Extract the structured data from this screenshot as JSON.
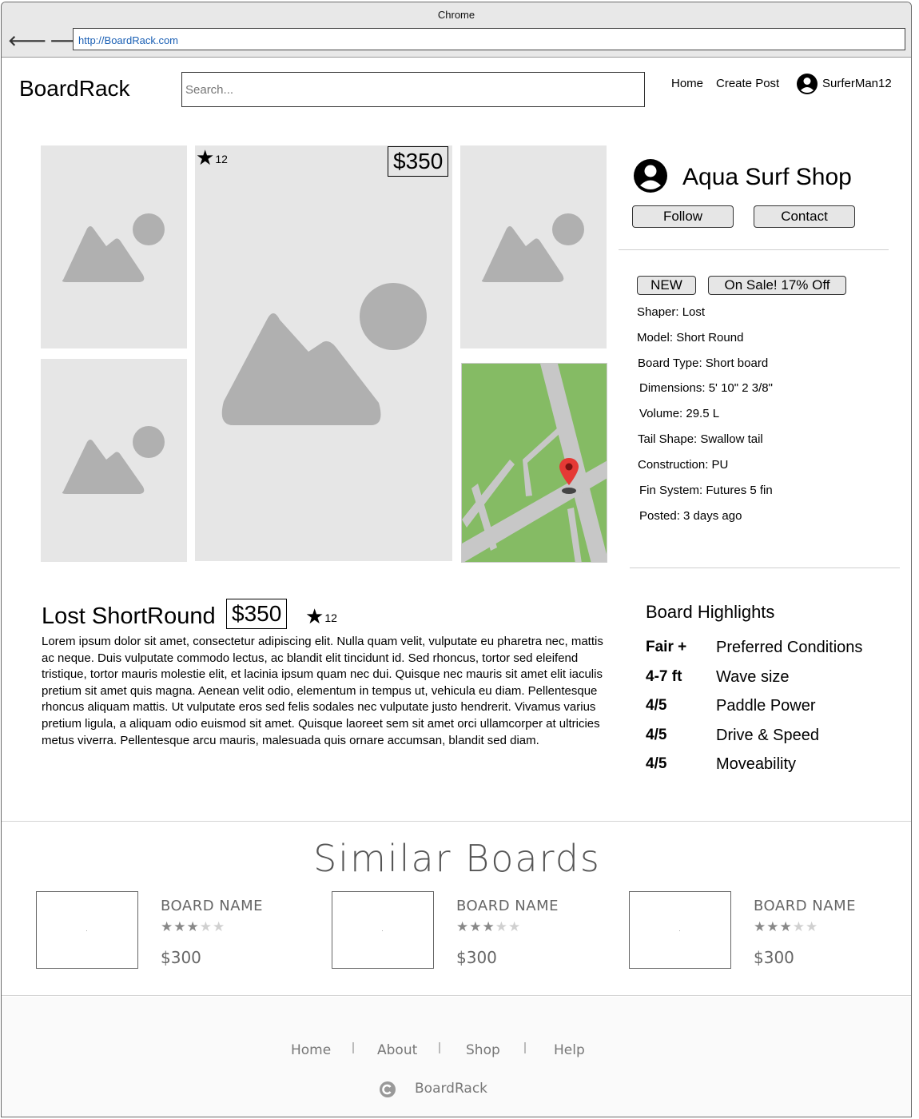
{
  "browser": {
    "title": "Chrome",
    "url": "http://BoardRack.com"
  },
  "header": {
    "logo": "BoardRack",
    "search_placeholder": "Search...",
    "nav": {
      "home": "Home",
      "create_post": "Create Post",
      "username": "SurferMan12"
    }
  },
  "gallery": {
    "rating_count": "12",
    "price": "$350"
  },
  "seller": {
    "name": "Aqua Surf Shop",
    "follow": "Follow",
    "contact": "Contact"
  },
  "tags": {
    "new": "NEW",
    "sale": "On Sale! 17% Off"
  },
  "specs": [
    "Shaper:  Lost",
    "Model:  Short Round",
    "Board Type: Short board",
    "Dimensions:  5' 10\" 2 3/8\"",
    "Volume: 29.5 L",
    "Tail Shape: Swallow tail",
    "Construction: PU",
    "Fin System: Futures 5 fin",
    "Posted: 3 days ago"
  ],
  "listing": {
    "title": "Lost ShortRound",
    "price": "$350",
    "rating_count": "12",
    "description": "Lorem ipsum dolor sit amet, consectetur adipiscing elit. Nulla quam velit, vulputate eu pharetra nec, mattis ac neque. Duis vulputate commodo lectus, ac blandit elit tincidunt id. Sed rhoncus, tortor sed eleifend tristique, tortor mauris molestie elit, et lacinia ipsum quam nec dui. Quisque nec mauris sit amet elit iaculis pretium sit amet quis magna. Aenean velit odio, elementum in tempus ut, vehicula eu diam. Pellentesque rhoncus aliquam mattis. Ut vulputate eros sed felis sodales nec vulputate justo hendrerit. Vivamus varius pretium ligula, a aliquam odio euismod sit amet. Quisque laoreet sem sit amet orci ullamcorper at ultricies metus viverra. Pellentesque arcu mauris, malesuada quis ornare accumsan, blandit sed diam."
  },
  "highlights": {
    "title": "Board Highlights",
    "items": [
      {
        "value": "Fair +",
        "label": "Preferred Conditions"
      },
      {
        "value": "4-7 ft",
        "label": "Wave size"
      },
      {
        "value": "4/5",
        "label": "Paddle Power"
      },
      {
        "value": "4/5",
        "label": "Drive & Speed"
      },
      {
        "value": "4/5",
        "label": "Moveability"
      }
    ]
  },
  "similar": {
    "title": "Similar Boards",
    "cards": [
      {
        "name": "BOARD NAME",
        "price": "$300",
        "stars": 3,
        "max_stars": 5
      },
      {
        "name": "BOARD NAME",
        "price": "$300",
        "stars": 3,
        "max_stars": 5
      },
      {
        "name": "BOARD NAME",
        "price": "$300",
        "stars": 3,
        "max_stars": 5
      }
    ]
  },
  "footer": {
    "links": [
      "Home",
      "About",
      "Shop",
      "Help"
    ],
    "brand": "BoardRack"
  },
  "colors": {
    "map_green": "#85bb64",
    "map_pin": "#e53935",
    "link_blue": "#1a5fb4"
  },
  "icons": [
    "back-arrow-icon",
    "forward-arrow-icon",
    "reload-icon",
    "user-icon",
    "star-icon",
    "image-placeholder-icon",
    "map-pin-icon",
    "copyright-icon"
  ]
}
